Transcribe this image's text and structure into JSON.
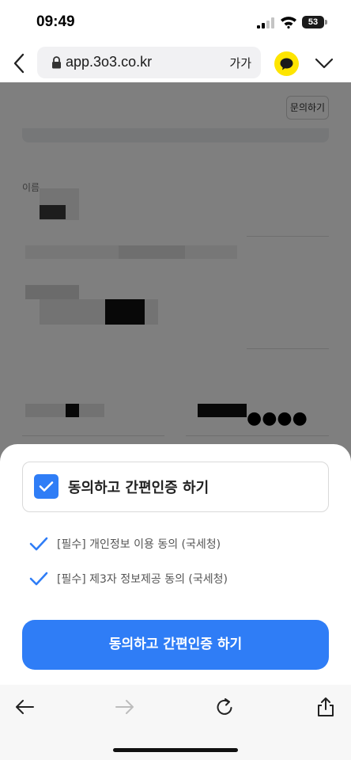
{
  "status_bar": {
    "time": "09:49",
    "battery": "53"
  },
  "browser": {
    "url": "app.3o3.co.kr",
    "text_size_label": "가가"
  },
  "page": {
    "inquiry_label": "문의하기",
    "name_label": "이름"
  },
  "sheet": {
    "agree_all_label": "동의하고 간편인증 하기",
    "items": [
      {
        "label": "[필수] 개인정보 이용 동의 (국세청)"
      },
      {
        "label": "[필수] 제3자 정보제공 동의 (국세청)"
      }
    ],
    "submit_label": "동의하고 간편인증 하기"
  },
  "colors": {
    "accent": "#2f7df6",
    "kakao": "#fee500"
  }
}
